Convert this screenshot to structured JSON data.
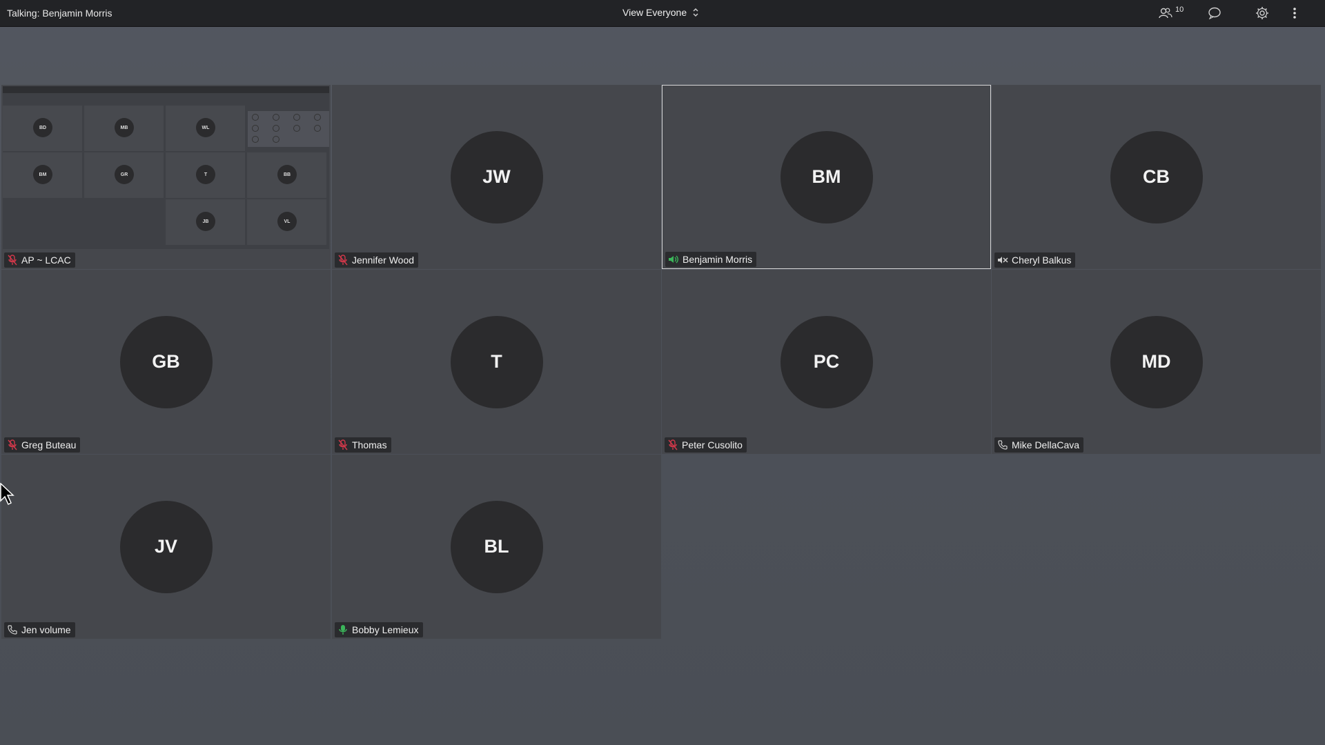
{
  "topbar": {
    "talking_label": "Talking: Benjamin Morris",
    "view_select": "View Everyone",
    "participant_count": "10"
  },
  "icons": {
    "participants": "participants-icon",
    "chat": "chat-icon",
    "settings": "gear-icon",
    "more": "more-vertical-icon"
  },
  "colors": {
    "muted": "#d2384a",
    "speaking": "#3bb55a",
    "phone": "#cfcfcf",
    "active_border": "#d9d9d9"
  },
  "tiles": [
    {
      "name": "AP ~ LCAC",
      "initials": "",
      "status": "muted",
      "screen_share": true
    },
    {
      "name": "Jennifer Wood",
      "initials": "JW",
      "status": "muted"
    },
    {
      "name": "Benjamin Morris",
      "initials": "BM",
      "status": "speaking",
      "active": true
    },
    {
      "name": "Cheryl Balkus",
      "initials": "CB",
      "status": "speaker-muted"
    },
    {
      "name": "Greg Buteau",
      "initials": "GB",
      "status": "muted"
    },
    {
      "name": "Thomas",
      "initials": "T",
      "status": "muted"
    },
    {
      "name": "Peter Cusolito",
      "initials": "PC",
      "status": "muted"
    },
    {
      "name": "Mike DellaCava",
      "initials": "MD",
      "status": "phone"
    },
    {
      "name": "Jen volume",
      "initials": "JV",
      "status": "phone"
    },
    {
      "name": "Bobby Lemieux",
      "initials": "BL",
      "status": "mic-on"
    }
  ],
  "share_preview": {
    "avatars": [
      "BD",
      "MB",
      "WL",
      "BM",
      "GR",
      "T",
      "BB",
      "JB",
      "VL"
    ]
  }
}
